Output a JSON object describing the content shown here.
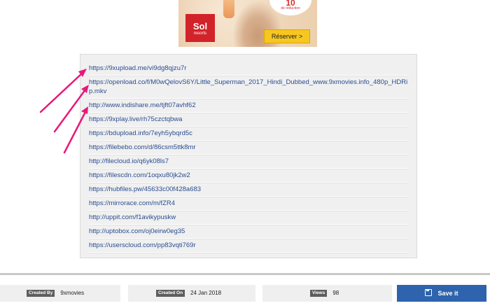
{
  "ad": {
    "discount": "10",
    "discount_sub": "de réduction",
    "logo_main": "Sol",
    "logo_sub": "resorts",
    "cta": "Réserver >"
  },
  "links": [
    "https://9xupload.me/vi9dg8qjzu7r",
    "https://openload.co/f/M0wQelovS6Y/Little_Superman_2017_Hindi_Dubbed_www.9xmovies.info_480p_HDRip.mkv",
    "http://www.indishare.me/tjft07avhf62",
    "https://9xplay.live/rh75czctqbwa",
    "https://bdupload.info/7eyh5ybqrd5c",
    "https://filebebo.com/d/86csm5ttk8mr",
    "http://filecloud.io/q6yk08ls7",
    "https://filescdn.com/1oqxu80jk2w2",
    "https://hubfiles.pw/45633c00f428a683",
    "https://mirrorace.com/m/fZR4",
    "http://uppit.com/f1avikypuskw",
    "http://uptobox.com/oj0eirw0eg35",
    "https://userscloud.com/pp83vqti769r"
  ],
  "footer": {
    "created_by_label": "Created By",
    "created_by_value": "9xmovies",
    "created_on_label": "Created On",
    "created_on_value": "24 Jan 2018",
    "views_label": "Views",
    "views_value": "98",
    "save_label": "Save it"
  },
  "colors": {
    "link": "#2a4d8f",
    "arrow": "#e8187a",
    "save_button": "#2e63ad",
    "tag": "#5e5e5e"
  }
}
